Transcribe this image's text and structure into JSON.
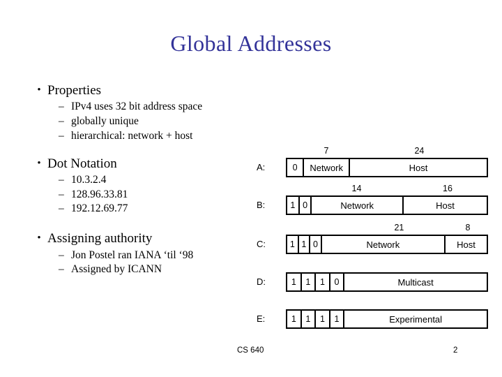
{
  "slide": {
    "title": "Global Addresses",
    "title_color": "#333399",
    "bullet_glyph": "•",
    "dash_glyph": "–"
  },
  "sections": [
    {
      "heading": "Properties",
      "items": [
        "IPv4 uses 32 bit address space",
        "globally unique",
        "hierarchical: network + host"
      ]
    },
    {
      "heading": "Dot Notation",
      "items": [
        "10.3.2.4",
        "128.96.33.81",
        "192.12.69.77"
      ]
    },
    {
      "heading": "Assigning authority",
      "items": [
        "Jon Postel ran IANA ‘til ‘98",
        "Assigned by ICANN"
      ]
    }
  ],
  "diagram": {
    "classes": [
      {
        "label": "A:",
        "cells": [
          {
            "text": "0",
            "kind": "bit"
          },
          {
            "text": "Network",
            "kind": "field"
          },
          {
            "text": "Host",
            "kind": "field"
          }
        ],
        "bitmarks": [
          {
            "text": "7"
          },
          {
            "text": "24"
          }
        ]
      },
      {
        "label": "B:",
        "cells": [
          {
            "text": "1",
            "kind": "bit"
          },
          {
            "text": "0",
            "kind": "bit"
          },
          {
            "text": "Network",
            "kind": "field"
          },
          {
            "text": "Host",
            "kind": "field"
          }
        ],
        "bitmarks": [
          {
            "text": "14"
          },
          {
            "text": "16"
          }
        ]
      },
      {
        "label": "C:",
        "cells": [
          {
            "text": "1",
            "kind": "bit"
          },
          {
            "text": "1",
            "kind": "bit"
          },
          {
            "text": "0",
            "kind": "bit"
          },
          {
            "text": "Network",
            "kind": "field"
          },
          {
            "text": "Host",
            "kind": "field"
          }
        ],
        "bitmarks": [
          {
            "text": "21"
          },
          {
            "text": "8"
          }
        ]
      },
      {
        "label": "D:",
        "cells": [
          {
            "text": "1",
            "kind": "bit"
          },
          {
            "text": "1",
            "kind": "bit"
          },
          {
            "text": "1",
            "kind": "bit"
          },
          {
            "text": "0",
            "kind": "bit"
          },
          {
            "text": "Multicast",
            "kind": "field"
          }
        ],
        "bitmarks": []
      },
      {
        "label": "E:",
        "cells": [
          {
            "text": "1",
            "kind": "bit"
          },
          {
            "text": "1",
            "kind": "bit"
          },
          {
            "text": "1",
            "kind": "bit"
          },
          {
            "text": "1",
            "kind": "bit"
          },
          {
            "text": "Experimental",
            "kind": "field"
          }
        ],
        "bitmarks": []
      }
    ]
  },
  "footer": {
    "course": "CS 640",
    "page_number": "2"
  }
}
